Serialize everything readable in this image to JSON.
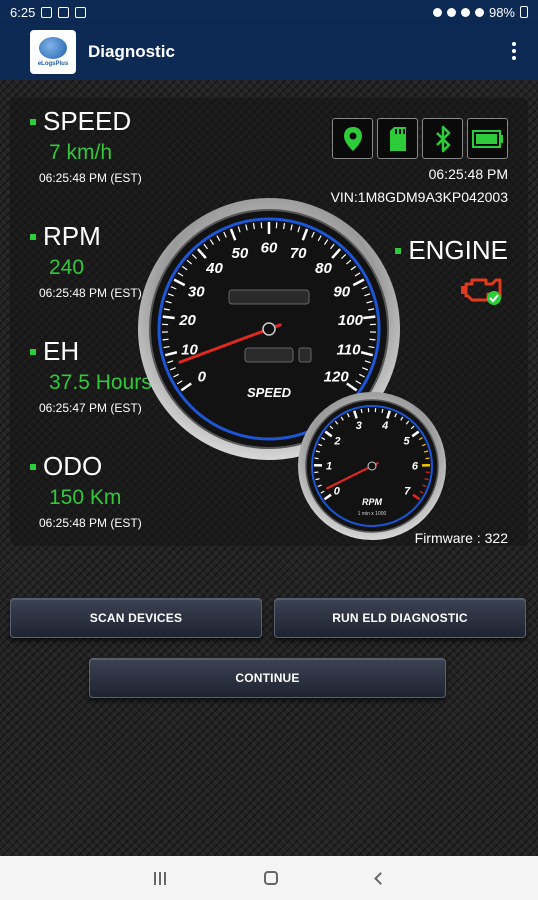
{
  "status_bar": {
    "time": "6:25",
    "battery": "98%"
  },
  "app_bar": {
    "title": "Diagnostic",
    "logo_text": "eLogsPlus",
    "menu_icon": "overflow-menu-icon"
  },
  "params": [
    {
      "label": "SPEED",
      "value": "7 km/h",
      "time": "06:25:48 PM (EST)"
    },
    {
      "label": "RPM",
      "value": "240",
      "time": "06:25:48 PM (EST)"
    },
    {
      "label": "EH",
      "value": "37.5 Hours",
      "time": "06:25:47 PM (EST)"
    },
    {
      "label": "ODO",
      "value": "150 Km",
      "time": "06:25:48 PM (EST)"
    }
  ],
  "status_icons": [
    "location-icon",
    "sd-card-icon",
    "bluetooth-icon",
    "battery-icon"
  ],
  "device_time": "06:25:48 PM",
  "vin": "VIN:1M8GDM9A3KP042003",
  "engine": {
    "label": "ENGINE",
    "icon": "check-engine-icon",
    "status": "ok"
  },
  "speedometer": {
    "label": "SPEED",
    "ticks": [
      "0",
      "10",
      "20",
      "30",
      "40",
      "50",
      "60",
      "70",
      "80",
      "90",
      "100",
      "110",
      "120"
    ],
    "reading": 7
  },
  "tachometer": {
    "label": "RPM",
    "sublabel": "1 min x 1000",
    "ticks": [
      "0",
      "1",
      "2",
      "3",
      "4",
      "5",
      "6",
      "7"
    ],
    "reading": 0.24
  },
  "firmware": "Firmware : 322",
  "buttons": {
    "scan": "SCAN DEVICES",
    "run": "RUN ELD DIAGNOSTIC",
    "continue": "CONTINUE"
  },
  "colors": {
    "app_bar": "#0d2a55",
    "value_green": "#32c83a",
    "needle_red": "#e0281e"
  }
}
